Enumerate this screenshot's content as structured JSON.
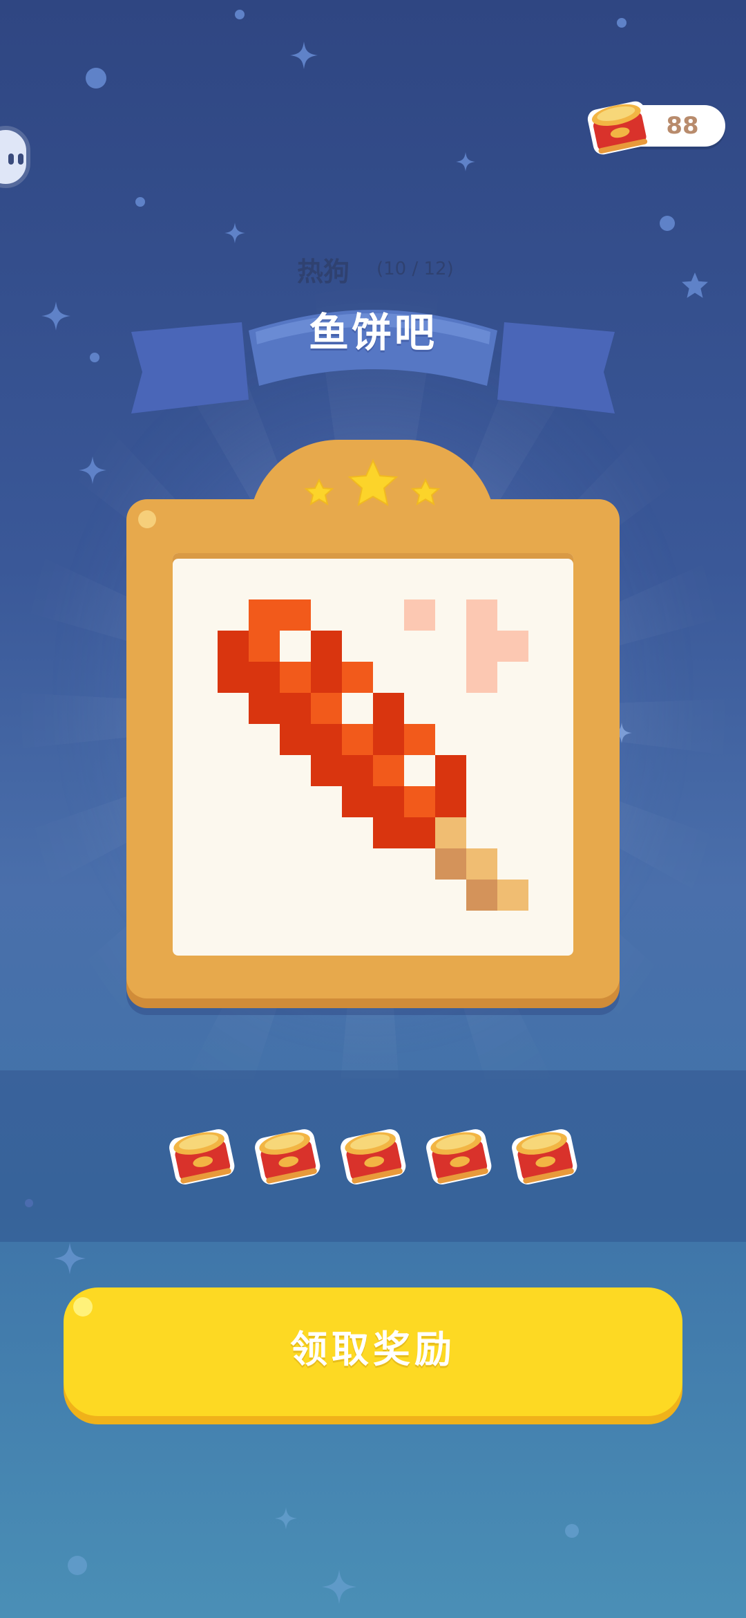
{
  "header": {
    "coin_count": "88",
    "coin_icon": "cat-food-can-icon"
  },
  "level": {
    "name": "热狗",
    "progress": "(10 / 12)",
    "title": "鱼饼吧",
    "stars": 3
  },
  "artwork": {
    "subject": "hot dog on a stick pixel art",
    "colors": {
      "red_dark": "#d9350f",
      "red_orange": "#f25a1b",
      "steam": "#fcc8b2",
      "stick_light": "#f0bd72",
      "stick_dark": "#d4935a",
      "paper": "#fcf8ee"
    }
  },
  "rewards": {
    "count": 5,
    "icon": "cat-food-can-icon"
  },
  "actions": {
    "claim_label": "领取奖励"
  },
  "colors": {
    "frame": "#e7a94c",
    "button": "#fdd923",
    "banner": "#5677c4"
  }
}
